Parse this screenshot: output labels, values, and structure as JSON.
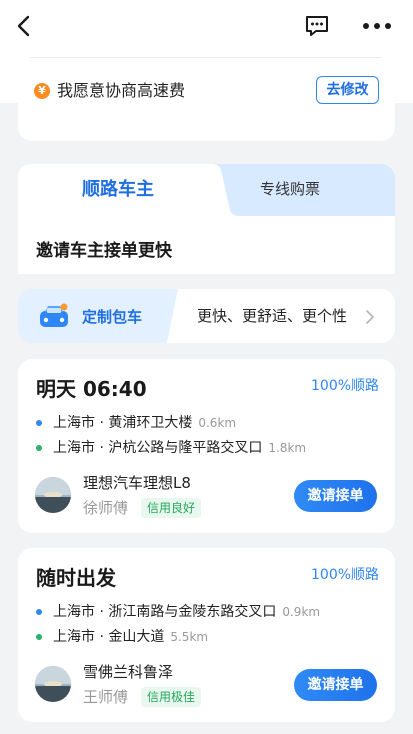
{
  "header": {
    "back_icon": "chevron-left-icon",
    "chat_icon": "chat-bubble-icon",
    "more_icon": "more-dots-icon"
  },
  "fee": {
    "icon_glyph": "¥",
    "text": "我愿意协商高速费",
    "button": "去修改"
  },
  "tabs": [
    {
      "label": "顺路车主",
      "active": true
    },
    {
      "label": "专线购票",
      "active": false
    }
  ],
  "invite_title": "邀请车主接单更快",
  "charter": {
    "label": "定制包车",
    "desc": "更快、更舒适、更个性"
  },
  "trips": [
    {
      "time": "明天 06:40",
      "route_match": "100%顺路",
      "from": "上海市 · 黄浦环卫大楼",
      "from_dist": "0.6km",
      "to": "上海市 · 沪杭公路与隆平路交叉口",
      "to_dist": "1.8km",
      "car": "理想汽车理想L8",
      "driver": "徐师傅",
      "credit": "信用良好",
      "button": "邀请接单"
    },
    {
      "time": "随时出发",
      "route_match": "100%顺路",
      "from": "上海市 · 浙江南路与金陵东路交叉口",
      "from_dist": "0.9km",
      "to": "上海市 · 金山大道",
      "to_dist": "5.5km",
      "car": "雪佛兰科鲁泽",
      "driver": "王师傅",
      "credit": "信用极佳",
      "button": "邀请接单"
    }
  ],
  "colors": {
    "accent": "#1f6fe0",
    "from_dot": "#2f86f6",
    "to_dot": "#26b36a",
    "credit_text": "#26a65b"
  }
}
